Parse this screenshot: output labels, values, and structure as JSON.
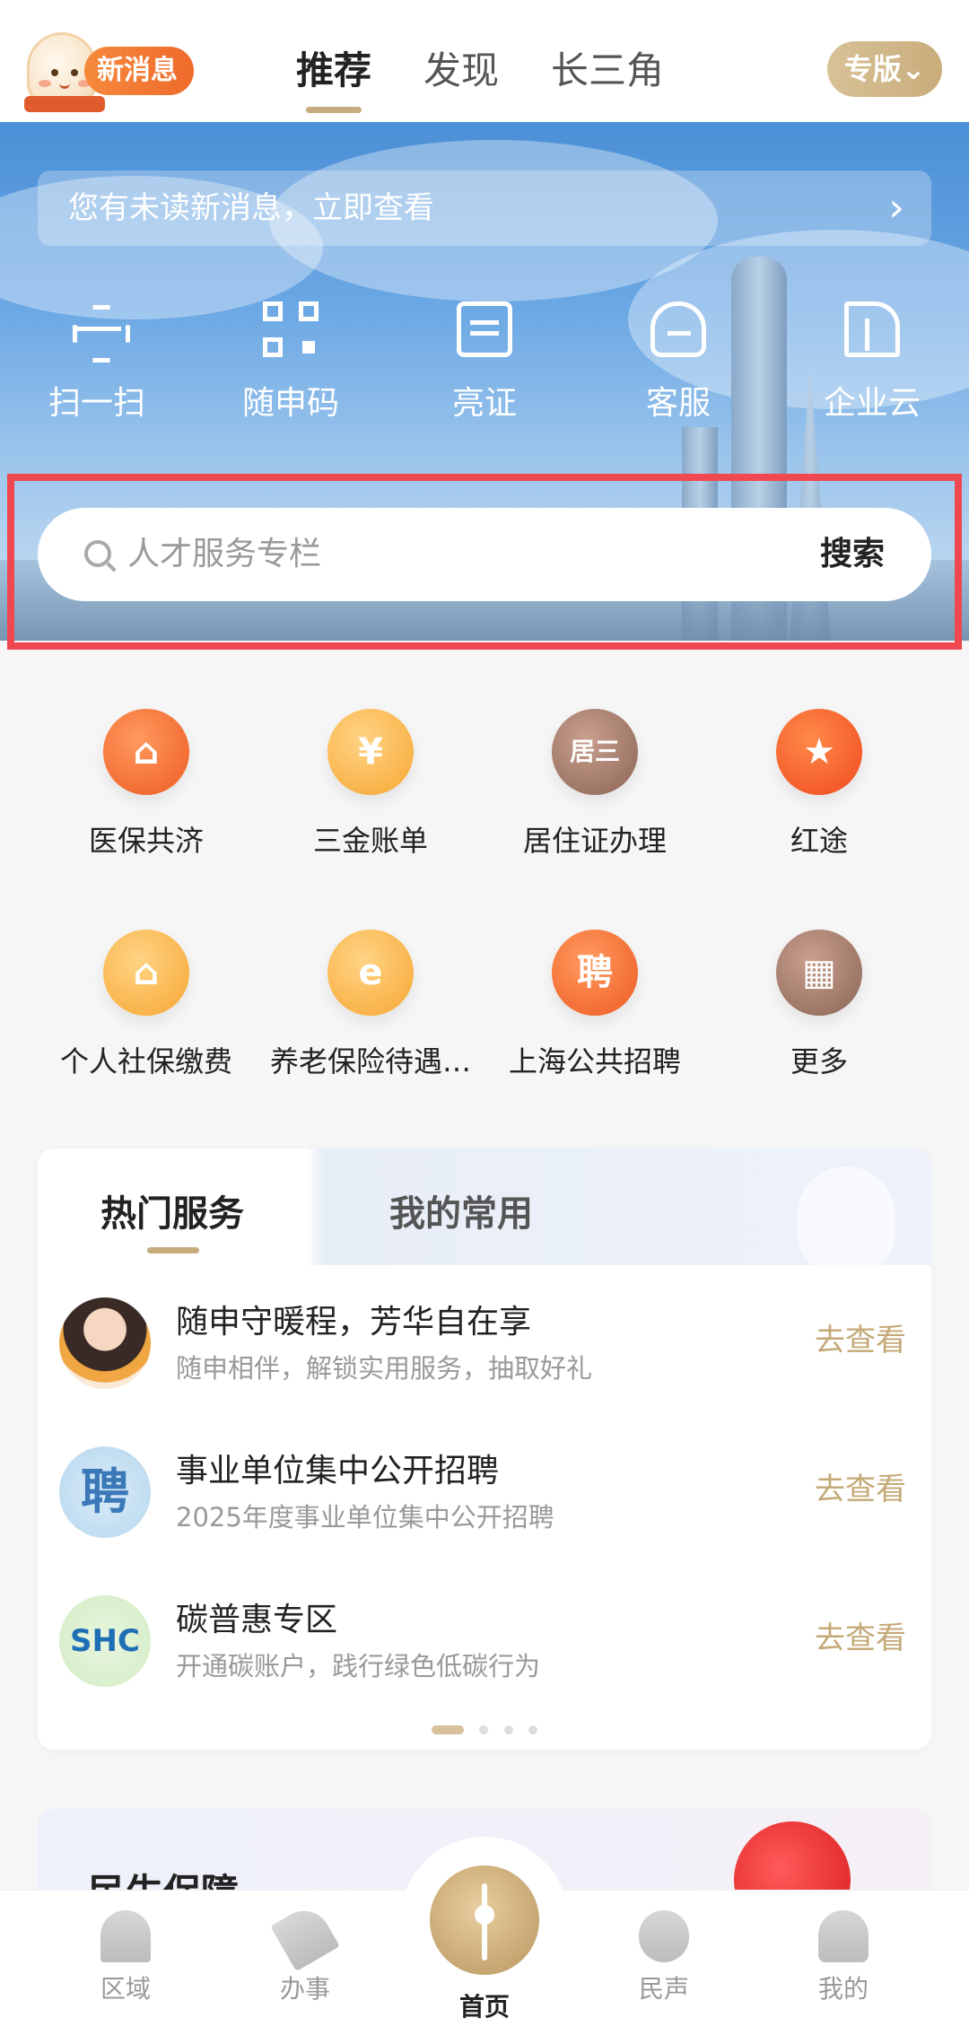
{
  "header": {
    "new_msg": "新消息",
    "tabs": [
      "推荐",
      "发现",
      "长三角"
    ],
    "active_tab": "推荐",
    "edition": "专版⌄"
  },
  "banner": {
    "notice": "您有未读新消息，立即查看",
    "notice_chevron": "›",
    "quick_actions": [
      "扫一扫",
      "随申码",
      "亮证",
      "客服",
      "企业云"
    ]
  },
  "search": {
    "placeholder": "人才服务专栏",
    "button": "搜索"
  },
  "services": [
    {
      "label": "医保共济",
      "icon": "family-home-icon",
      "glyph": "⌂"
    },
    {
      "label": "三金账单",
      "icon": "yuan-coin-icon",
      "glyph": "¥"
    },
    {
      "label": "居住证办理",
      "icon": "residence-card-icon",
      "glyph": "居三"
    },
    {
      "label": "红途",
      "icon": "red-star-icon",
      "glyph": "★"
    },
    {
      "label": "个人社保缴费",
      "icon": "social-insurance-icon",
      "glyph": "⌂"
    },
    {
      "label": "养老保险待遇…",
      "icon": "pension-doc-icon",
      "glyph": "e"
    },
    {
      "label": "上海公共招聘",
      "icon": "recruit-icon",
      "glyph": "聘"
    },
    {
      "label": "更多",
      "icon": "more-grid-icon",
      "glyph": "▦"
    }
  ],
  "hot": {
    "tab_hot": "热门服务",
    "tab_mine": "我的常用",
    "items": [
      {
        "title": "随申守暖程，芳华自在享",
        "subtitle": "随申相伴，解锁实用服务，抽取好礼",
        "action": "去查看",
        "thumb_text": ""
      },
      {
        "title": "事业单位集中公开招聘",
        "subtitle": "2025年度事业单位集中公开招聘",
        "action": "去查看",
        "thumb_text": "聘"
      },
      {
        "title": "碳普惠专区",
        "subtitle": "开通碳账户，践行绿色低碳行为",
        "action": "去查看",
        "thumb_text": "SHC"
      }
    ]
  },
  "livelihood": {
    "title": "民生保障"
  },
  "nav": {
    "items": [
      "区域",
      "办事",
      "首页",
      "民声",
      "我的"
    ],
    "active": "首页"
  },
  "colors": {
    "accent_gold": "#c7ad7d",
    "highlight_red": "#f0484f",
    "sky_blue": "#4b8fd6"
  }
}
